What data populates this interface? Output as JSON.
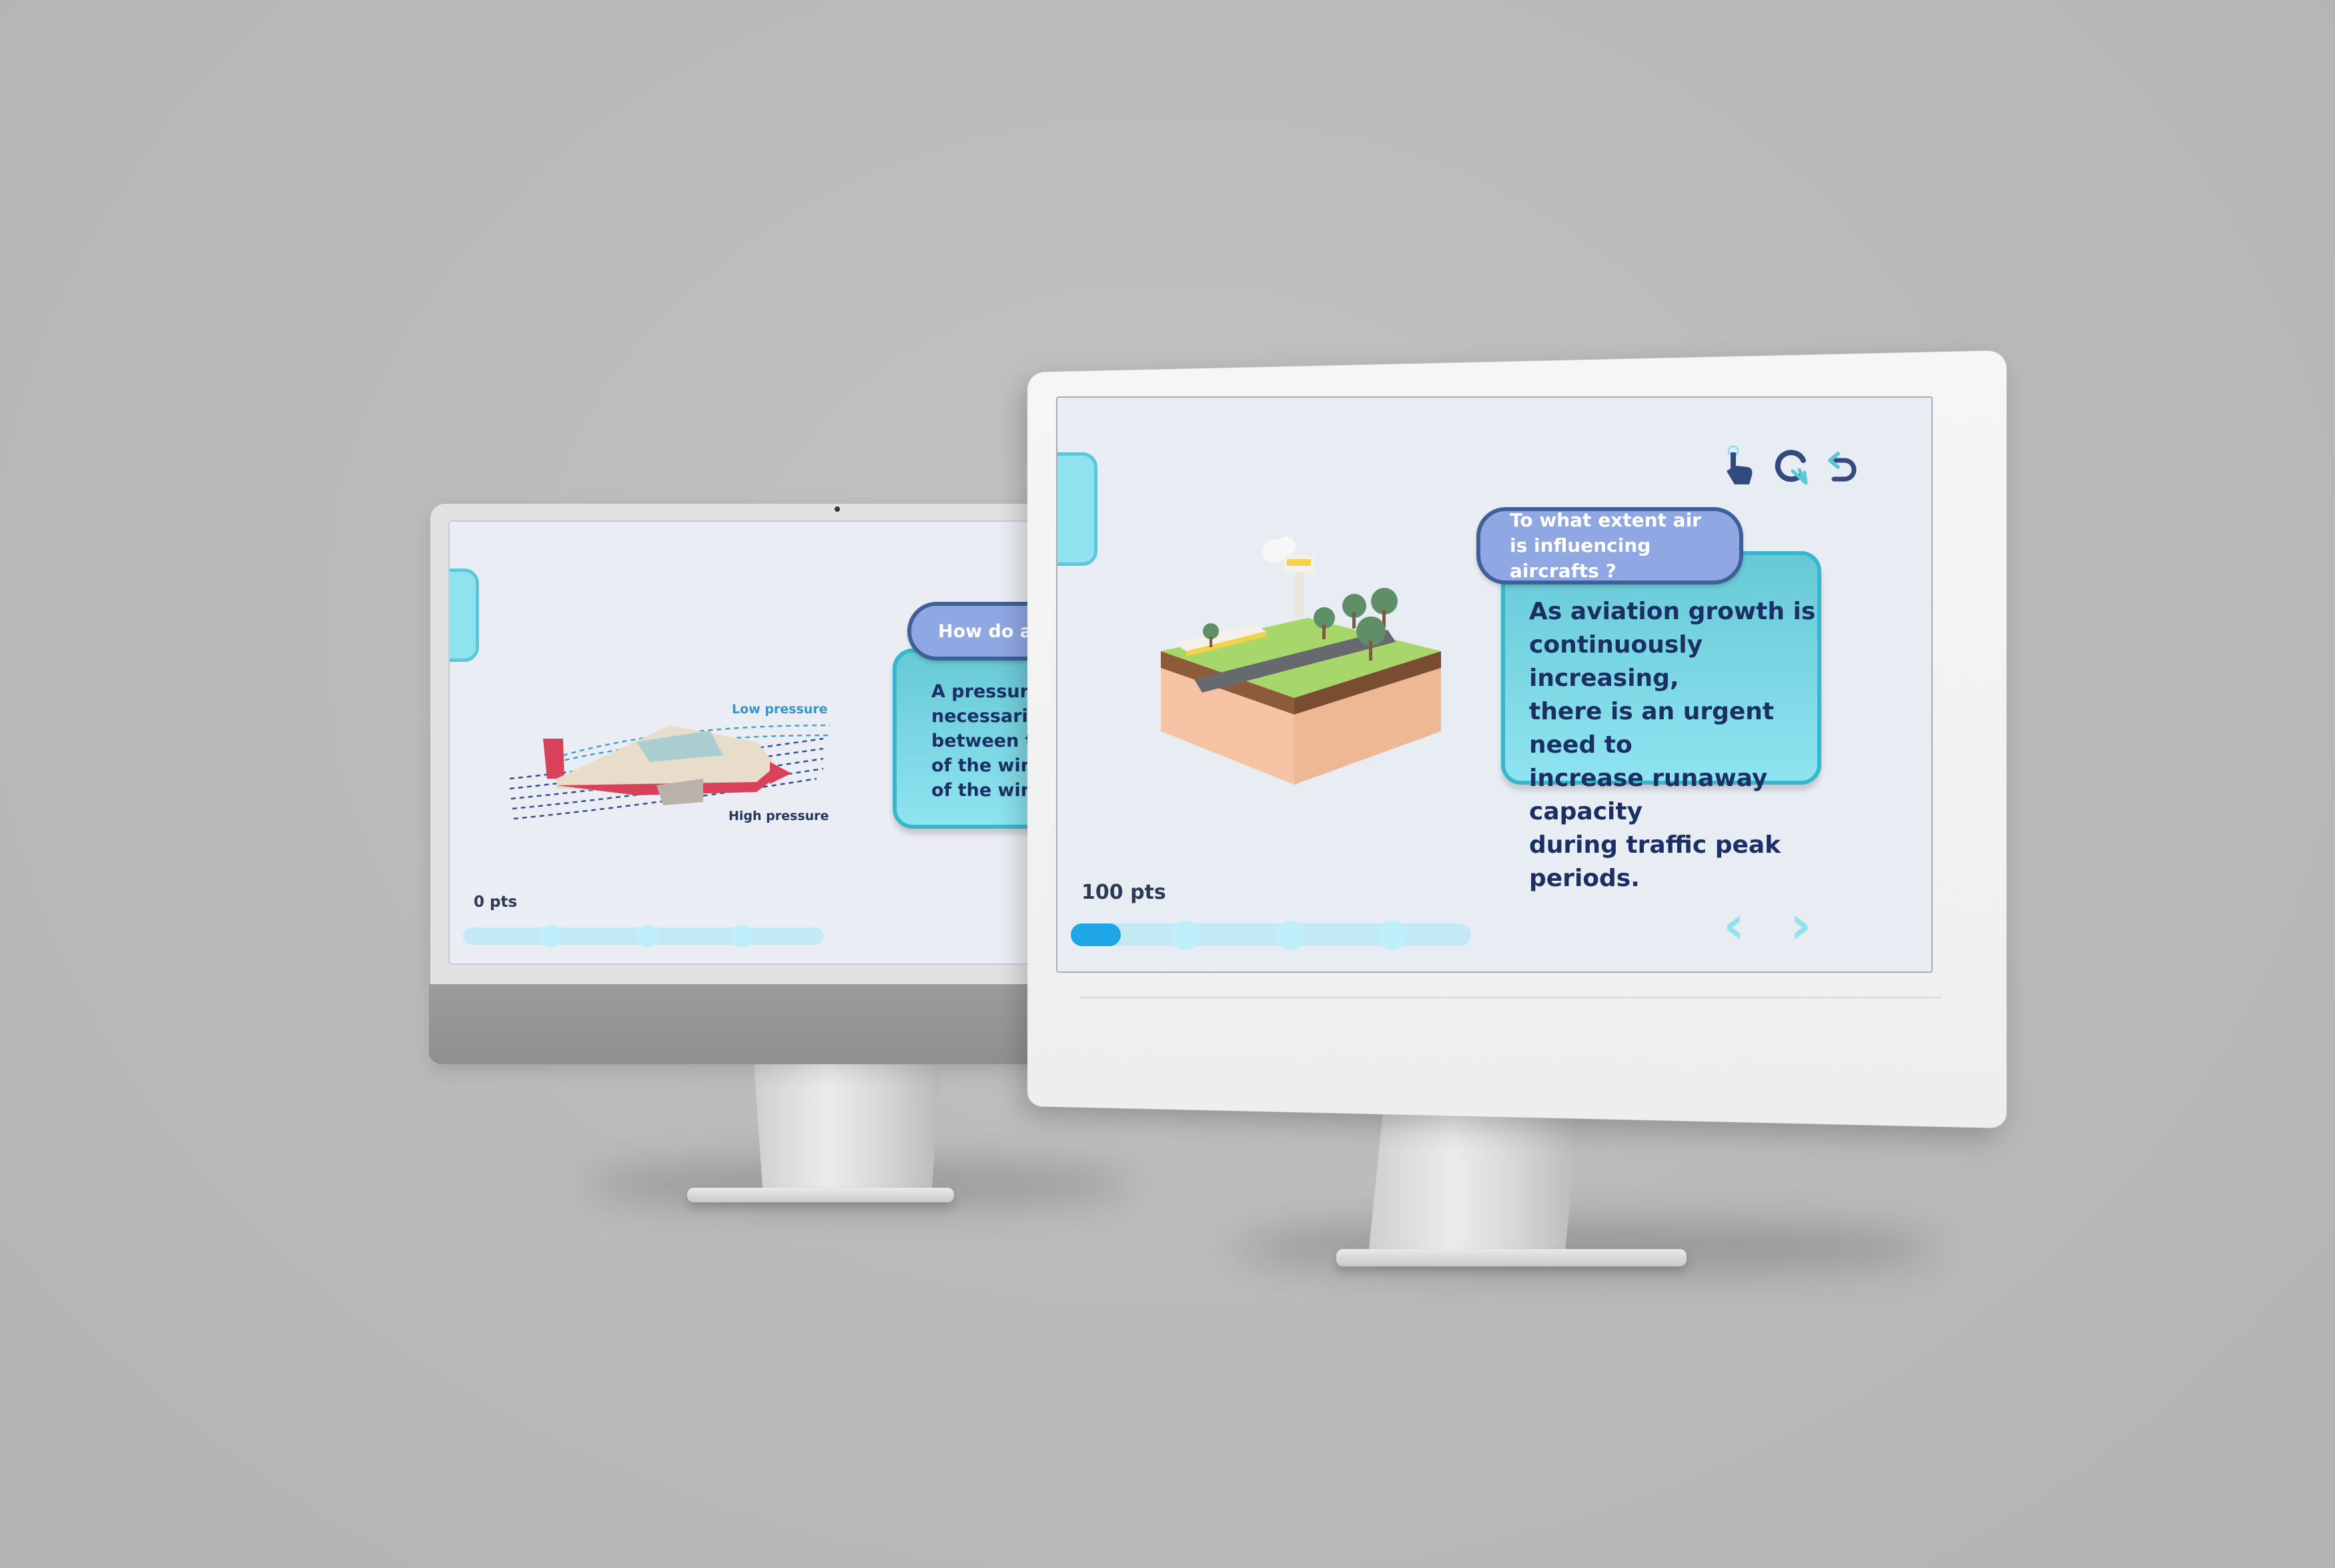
{
  "left_screen": {
    "question": "How do airpl",
    "answer": "A pressure dif\nnecessarily cr\nbetween the u\nof the wing an\nof the wing.",
    "diagram": {
      "low_label": "Low pressure",
      "high_label": "High pressure"
    },
    "points": "0 pts",
    "progress": {
      "value": 0,
      "steps": 4
    }
  },
  "right_screen": {
    "question": "To what extent air is influencing aircrafts ?",
    "answer": "As aviation growth is\ncontinuously increasing,\nthere is an urgent need to\nincrease runaway capacity\nduring traffic peak periods.",
    "points": "100 pts",
    "progress": {
      "value": 0.25,
      "steps": 4
    },
    "toolbar": {
      "icons": [
        "tap-hand-icon",
        "replay-icon",
        "undo-icon"
      ]
    },
    "nav": {
      "prev": "‹",
      "next": "›"
    }
  },
  "colors": {
    "accent": "#1ea6e6",
    "card": "#8ee4f0",
    "pill": "#8fa7e3",
    "pill_border": "#3f5f99",
    "text_dark": "#1b2f64"
  }
}
